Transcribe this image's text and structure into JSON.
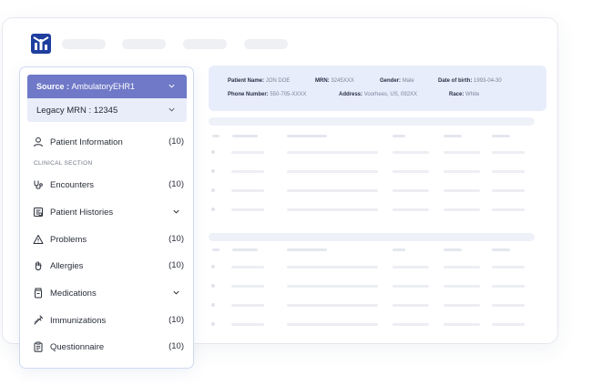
{
  "patient_banner": {
    "name_label": "Patient Name:",
    "name_value": "JON DOE",
    "mrn_label": "MRN:",
    "mrn_value": "3245XXX",
    "gender_label": "Gender:",
    "gender_value": "Male",
    "dob_label": "Date of birth:",
    "dob_value": "1993-04-30",
    "phone_label": "Phone Number:",
    "phone_value": "550-705-XXXX",
    "address_label": "Address:",
    "address_value": "Voorhees, US, 092XX",
    "race_label": "Race:",
    "race_value": "White"
  },
  "sidebar": {
    "source_label": "Source :",
    "source_value": "AmbulatoryEHR1",
    "legacy_label": "Legacy MRN :",
    "legacy_value": "12345",
    "clinical_section_label": "CLINICAL SECTION",
    "items": [
      {
        "label": "Patient Information",
        "count": "(10)",
        "icon": "person-icon"
      },
      {
        "label": "Encounters",
        "count": "(10)",
        "icon": "stethoscope-icon"
      },
      {
        "label": "Patient Histories",
        "count": "",
        "icon": "history-document-icon"
      },
      {
        "label": "Problems",
        "count": "(10)",
        "icon": "warning-icon"
      },
      {
        "label": "Allergies",
        "count": "(10)",
        "icon": "hand-icon"
      },
      {
        "label": "Medications",
        "count": "",
        "icon": "pill-bottle-icon"
      },
      {
        "label": "Immunizations",
        "count": "(10)",
        "icon": "syringe-icon"
      },
      {
        "label": "Questionnaire",
        "count": "(10)",
        "icon": "clipboard-icon"
      }
    ]
  },
  "colors": {
    "brand": "#1f3f9e",
    "source_bg": "#6f79c8",
    "legacy_bg": "#e9edf9",
    "banner_bg": "#e8edfb"
  }
}
